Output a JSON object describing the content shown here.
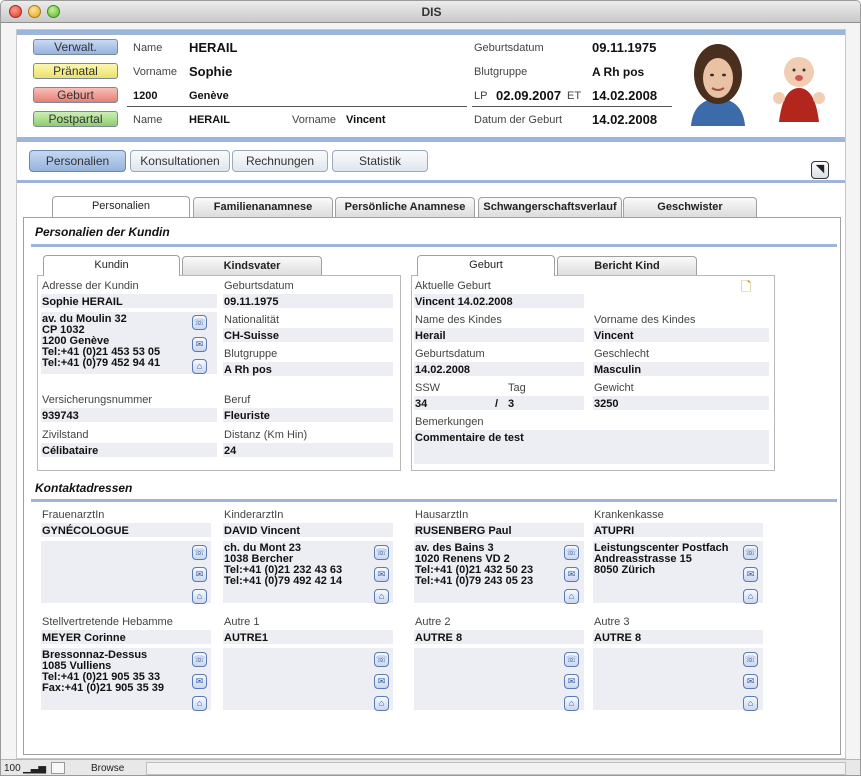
{
  "window": {
    "title": "DIS"
  },
  "header": {
    "buttons": [
      {
        "label": "Verwalt.",
        "color": "#a8c2e8"
      },
      {
        "label": "Pränatal",
        "color": "#f4ef8a"
      },
      {
        "label": "Geburt",
        "color": "#f19a92"
      },
      {
        "label": "Postpartal",
        "color": "#a9db8a"
      }
    ],
    "name_label": "Name",
    "name": "HERAIL",
    "vorname_label": "Vorname",
    "vorname": "Sophie",
    "postal_code": "1200",
    "city": "Genève",
    "child_name_label": "Name",
    "child_name": "HERAIL",
    "child_vorname_label": "Vorname",
    "child_vorname": "Vincent",
    "geburtsdatum_label": "Geburtsdatum",
    "geburtsdatum": "09.11.1975",
    "blutgruppe_label": "Blutgruppe",
    "blutgruppe": "A Rh pos",
    "lp_label": "LP",
    "lp": "02.09.2007",
    "et_label": "ET",
    "et": "14.02.2008",
    "datum_geburt_label": "Datum der Geburt",
    "datum_geburt": "14.02.2008"
  },
  "nav": {
    "buttons": [
      "Personalien",
      "Konsultationen",
      "Rechnungen",
      "Statistik"
    ],
    "active": "Personalien"
  },
  "tabs": [
    "Personalien",
    "Familienanamnese",
    "Persönliche Anamnese",
    "Schwangerschaftsverlauf",
    "Geschwister"
  ],
  "section1": {
    "title": "Personalien der Kundin"
  },
  "kundin": {
    "tabs": [
      "Kundin",
      "Kindsvater"
    ],
    "adresse_label": "Adresse der Kundin",
    "name": "Sophie HERAIL",
    "address": "av. du Moulin 32\nCP 1032\n1200 Genève\nTel:+41 (0)21 453 53 05\nTel:+41 (0)79 452 94 41",
    "geburtsdatum_label": "Geburtsdatum",
    "geburtsdatum": "09.11.1975",
    "nationalitaet_label": "Nationalität",
    "nationalitaet": "CH-Suisse",
    "blutgruppe_label": "Blutgruppe",
    "blutgruppe": "A Rh pos",
    "versicherung_label": "Versicherungsnummer",
    "versicherung": "939743",
    "beruf_label": "Beruf",
    "beruf": "Fleuriste",
    "zivilstand_label": "Zivilstand",
    "zivilstand": "Célibataire",
    "distanz_label": "Distanz (Km Hin)",
    "distanz": "24"
  },
  "geburt": {
    "tabs": [
      "Geburt",
      "Bericht Kind"
    ],
    "aktuelle_label": "Aktuelle Geburt",
    "aktuelle": "Vincent 14.02.2008",
    "name_kind_label": "Name des Kindes",
    "name_kind": "Herail",
    "vorname_kind_label": "Vorname des Kindes",
    "vorname_kind": "Vincent",
    "geburtsdatum_label": "Geburtsdatum",
    "geburtsdatum": "14.02.2008",
    "geschlecht_label": "Geschlecht",
    "geschlecht": "Masculin",
    "ssw_label": "SSW",
    "ssw": "34",
    "slash": "/",
    "tag_label": "Tag",
    "tag": "3",
    "gewicht_label": "Gewicht",
    "gewicht": "3250",
    "bemerkungen_label": "Bemerkungen",
    "bemerkungen": "Commentaire de test"
  },
  "section2": {
    "title": "Kontaktadressen"
  },
  "contacts": [
    {
      "role": "FrauenarztIn",
      "name": "GYNÉCOLOGUE",
      "address": ""
    },
    {
      "role": "KinderarztIn",
      "name": "DAVID Vincent",
      "address": "ch. du Mont 23\n1038 Bercher\nTel:+41 (0)21 232 43 63\nTel:+41 (0)79 492 42 14"
    },
    {
      "role": "HausarztIn",
      "name": "RUSENBERG Paul",
      "address": "av. des Bains 3\n1020 Renens VD 2\nTel:+41 (0)21 432 50 23\nTel:+41 (0)79 243 05 23"
    },
    {
      "role": "Krankenkasse",
      "name": "ATUPRI",
      "address": "Leistungscenter Postfach\nAndreasstrasse 15\n8050 Zürich"
    },
    {
      "role": "Stellvertretende Hebamme",
      "name": "MEYER Corinne",
      "address": "Bressonnaz-Dessus\n1085 Vulliens\nTel:+41 (0)21 905 35 33\nFax:+41 (0)21 905 35 39"
    },
    {
      "role": "Autre 1",
      "name": "AUTRE1",
      "address": ""
    },
    {
      "role": "Autre 2",
      "name": "AUTRE 8",
      "address": ""
    },
    {
      "role": "Autre 3",
      "name": "AUTRE 8",
      "address": ""
    }
  ],
  "status": {
    "zoom": "100",
    "mode": "Browse"
  }
}
